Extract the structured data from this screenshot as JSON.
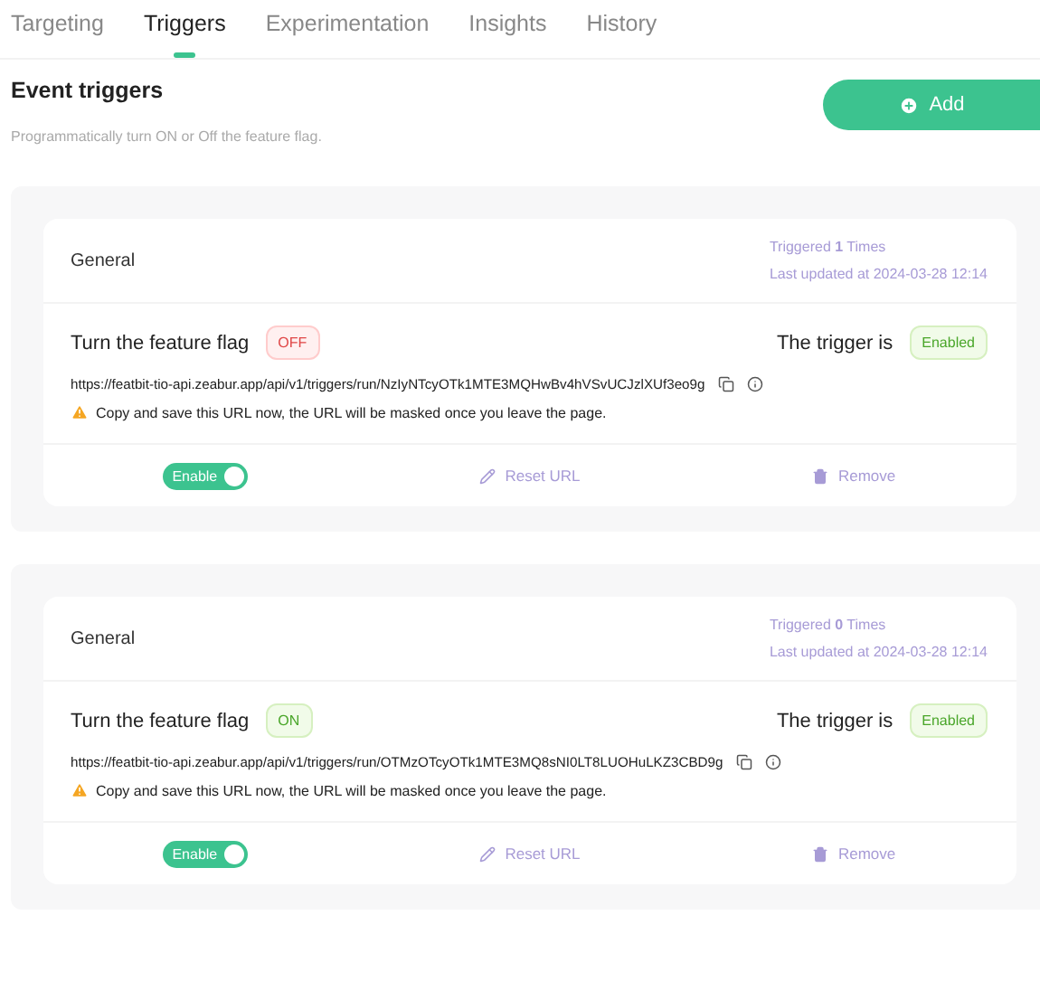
{
  "tabs": [
    {
      "label": "Targeting",
      "selected": false
    },
    {
      "label": "Triggers",
      "selected": true
    },
    {
      "label": "Experimentation",
      "selected": false
    },
    {
      "label": "Insights",
      "selected": false
    },
    {
      "label": "History",
      "selected": false
    }
  ],
  "header": {
    "title": "Event triggers",
    "description": "Programmatically turn ON or Off the feature flag.",
    "add_button": "Add"
  },
  "triggers": [
    {
      "name": "General",
      "triggered": "Triggered **1** Times",
      "updated": "Last updated at 2024-03-28 12:14",
      "action_label": "Turn the feature flag",
      "action": {
        "label": "OFF",
        "kind": "off"
      },
      "status_label": "The trigger is",
      "status": "Enabled",
      "url": "https://featbit-tio-api.zeabur.app/api/v1/triggers/run/NzIyNTcyOTk1MTE3MQHwBv4hVSvUCJzlXUf3eo9g",
      "warning": "Copy and save this URL now, the URL will be masked once you leave the page.",
      "switch": {
        "label": "Enable",
        "on": true
      },
      "reset": "Reset URL",
      "remove": "Remove"
    },
    {
      "name": "General",
      "triggered": "Triggered **0** Times",
      "updated": "Last updated at 2024-03-28 12:14",
      "action_label": "Turn the feature flag",
      "action": {
        "label": "ON",
        "kind": "on"
      },
      "status_label": "The trigger is",
      "status": "Enabled",
      "url": "https://featbit-tio-api.zeabur.app/api/v1/triggers/run/OTMzOTcyOTk1MTE3MQ8sNI0LT8LUOHuLKZ3CBD9g",
      "warning": "Copy and save this URL now, the URL will be masked once you leave the page.",
      "switch": {
        "label": "Enable",
        "on": true
      },
      "reset": "Reset URL",
      "remove": "Remove"
    }
  ]
}
